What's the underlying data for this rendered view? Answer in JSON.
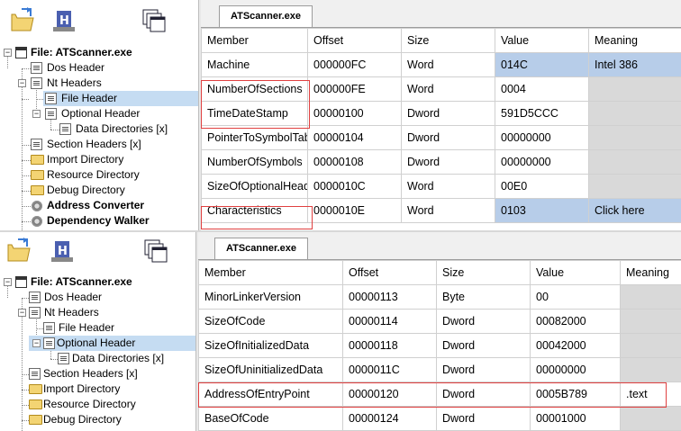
{
  "screens": [
    {
      "tab": "ATScanner.exe",
      "tree": [
        {
          "label": "File: ATScanner.exe",
          "bold": true,
          "icon": "window-icon"
        },
        {
          "label": "Dos Header",
          "icon": "document-icon"
        },
        {
          "label": "Nt Headers",
          "icon": "document-icon"
        },
        {
          "label": "File Header",
          "icon": "document-icon",
          "selected": true
        },
        {
          "label": "Optional Header",
          "icon": "document-icon"
        },
        {
          "label": "Data Directories [x]",
          "icon": "document-icon"
        },
        {
          "label": "Section Headers [x]",
          "icon": "document-icon"
        },
        {
          "label": "Import Directory",
          "icon": "folder-icon"
        },
        {
          "label": "Resource Directory",
          "icon": "folder-icon"
        },
        {
          "label": "Debug Directory",
          "icon": "folder-icon"
        },
        {
          "label": "Address Converter",
          "bold": true,
          "icon": "gear-icon"
        },
        {
          "label": "Dependency Walker",
          "bold": true,
          "icon": "gear-icon"
        }
      ],
      "columns": [
        "Member",
        "Offset",
        "Size",
        "Value",
        "Meaning"
      ],
      "rows": [
        [
          "Machine",
          "000000FC",
          "Word",
          "014C",
          "Intel 386"
        ],
        [
          "NumberOfSections",
          "000000FE",
          "Word",
          "0004",
          ""
        ],
        [
          "TimeDateStamp",
          "00000100",
          "Dword",
          "591D5CCC",
          ""
        ],
        [
          "PointerToSymbolTable",
          "00000104",
          "Dword",
          "00000000",
          ""
        ],
        [
          "NumberOfSymbols",
          "00000108",
          "Dword",
          "00000000",
          ""
        ],
        [
          "SizeOfOptionalHeader",
          "0000010C",
          "Word",
          "00E0",
          ""
        ],
        [
          "Characteristics",
          "0000010E",
          "Word",
          "0103",
          "Click here"
        ]
      ]
    },
    {
      "tab": "ATScanner.exe",
      "tree": [
        {
          "label": "File: ATScanner.exe",
          "bold": true,
          "icon": "window-icon"
        },
        {
          "label": "Dos Header",
          "icon": "document-icon"
        },
        {
          "label": "Nt Headers",
          "icon": "document-icon"
        },
        {
          "label": "File Header",
          "icon": "document-icon"
        },
        {
          "label": "Optional Header",
          "icon": "document-icon",
          "selected": true
        },
        {
          "label": "Data Directories [x]",
          "icon": "document-icon"
        },
        {
          "label": "Section Headers [x]",
          "icon": "document-icon"
        },
        {
          "label": "Import Directory",
          "icon": "folder-icon"
        },
        {
          "label": "Resource Directory",
          "icon": "folder-icon"
        },
        {
          "label": "Debug Directory",
          "icon": "folder-icon"
        }
      ],
      "columns": [
        "Member",
        "Offset",
        "Size",
        "Value",
        "Meaning"
      ],
      "rows": [
        [
          "MinorLinkerVersion",
          "00000113",
          "Byte",
          "00",
          ""
        ],
        [
          "SizeOfCode",
          "00000114",
          "Dword",
          "00082000",
          ""
        ],
        [
          "SizeOfInitializedData",
          "00000118",
          "Dword",
          "00042000",
          ""
        ],
        [
          "SizeOfUninitializedData",
          "0000011C",
          "Dword",
          "00000000",
          ""
        ],
        [
          "AddressOfEntryPoint",
          "00000120",
          "Dword",
          "0005B789",
          ".text"
        ],
        [
          "BaseOfCode",
          "00000124",
          "Dword",
          "00001000",
          ""
        ]
      ]
    }
  ],
  "colors": {
    "selection": "#c5dcf2",
    "highlight": "#b7cde9",
    "annotation": "#e04040",
    "empty_meaning": "#d9d9d9"
  }
}
